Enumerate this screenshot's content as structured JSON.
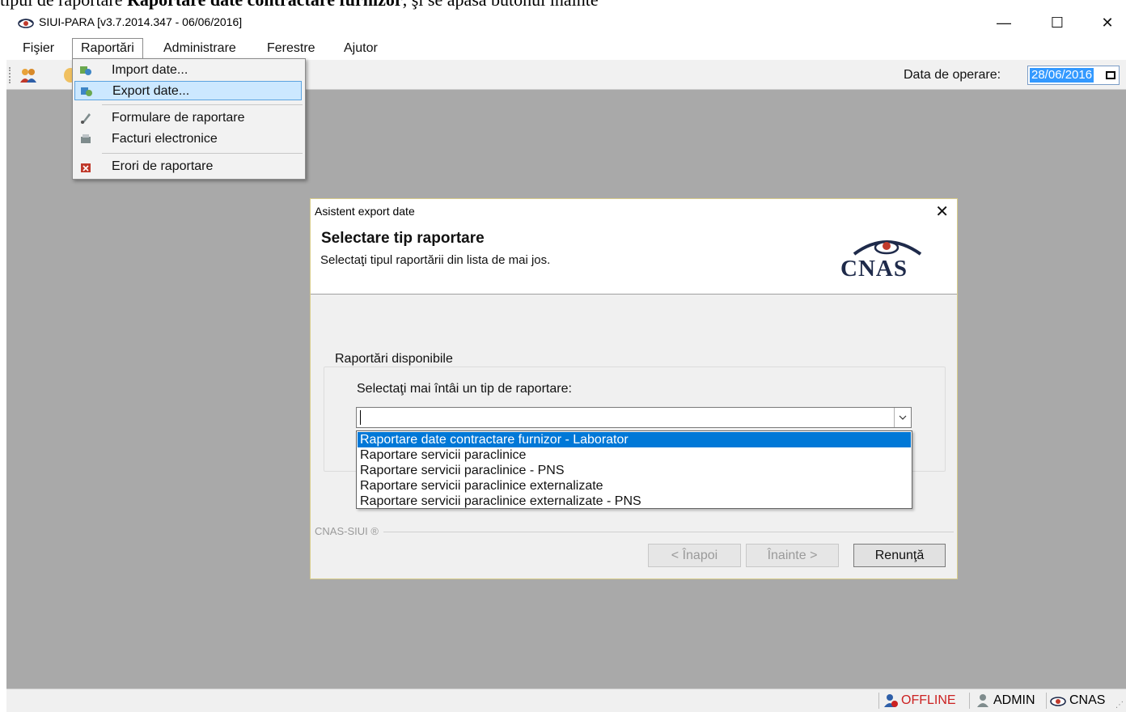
{
  "document": {
    "line_prefix": "tipul de raportare ",
    "line_bold": "Raportare date contractare furnizor",
    "line_suffix": ", şi se apasă butonul înainte"
  },
  "window": {
    "title": "SIUI-PARA [v3.7.2014.347 - 06/06/2016]",
    "minimize": "—",
    "maximize": "☐",
    "close": "✕"
  },
  "menubar": {
    "items": [
      "Fişier",
      "Raportări",
      "Administrare",
      "Ferestre",
      "Ajutor"
    ]
  },
  "toolbar": {
    "operation_date_label": "Data de operare:",
    "operation_date_value": "28/06/2016"
  },
  "raportari_menu": {
    "items": [
      {
        "label": "Import date...",
        "icon": "import-icon"
      },
      {
        "label": "Export date...",
        "icon": "export-icon"
      },
      {
        "label": "Formulare de raportare",
        "icon": "forms-icon"
      },
      {
        "label": "Facturi electronice",
        "icon": "invoice-icon"
      },
      {
        "label": "Erori de raportare",
        "icon": "error-icon"
      }
    ]
  },
  "dialog": {
    "title": "Asistent export date",
    "close": "✕",
    "heading": "Selectare tip raportare",
    "subheading": "Selectaţi tipul raportării din lista de mai jos.",
    "logo_text": "CNAS",
    "group_title": "Raportări disponibile",
    "combo_label": "Selectaţi mai întâi un tip de raportare:",
    "combo_value": "",
    "options": [
      "Raportare date contractare furnizor - Laborator",
      "Raportare servicii paraclinice",
      "Raportare servicii paraclinice - PNS",
      "Raportare servicii paraclinice externalizate",
      "Raportare servicii paraclinice externalizate - PNS"
    ],
    "footer_brand": "CNAS-SIUI ®",
    "buttons": {
      "back": "< Înapoi",
      "next": "Înainte >",
      "cancel": "Renunţă"
    }
  },
  "statusbar": {
    "offline": "OFFLINE",
    "user": "ADMIN",
    "org": "CNAS"
  },
  "colors": {
    "accent": "#0078d7",
    "highlight": "#cce8ff",
    "offline": "#cc2222",
    "desktop": "#a9a9a9"
  }
}
